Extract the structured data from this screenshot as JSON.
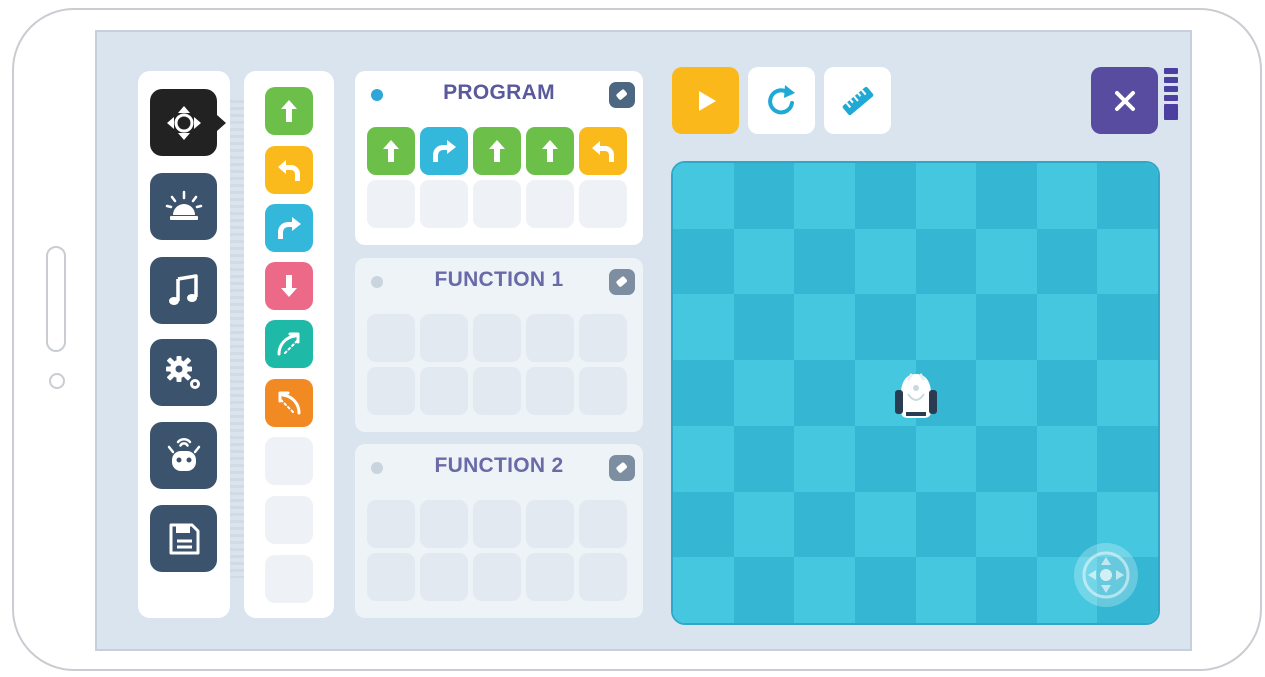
{
  "device": {
    "type": "phone-landscape"
  },
  "categories": [
    {
      "name": "movement",
      "icon": "move-icon",
      "active": true
    },
    {
      "name": "lights",
      "icon": "siren-icon",
      "active": false
    },
    {
      "name": "sound",
      "icon": "music-note-icon",
      "active": false
    },
    {
      "name": "settings",
      "icon": "gears-icon",
      "active": false
    },
    {
      "name": "robot",
      "icon": "robot-icon",
      "active": false
    },
    {
      "name": "save",
      "icon": "floppy-disk-icon",
      "active": false
    }
  ],
  "palette_blocks": [
    {
      "icon": "arrow-up-icon",
      "color": "#6cc04a"
    },
    {
      "icon": "turn-left-icon",
      "color": "#fbba1b"
    },
    {
      "icon": "turn-right-icon",
      "color": "#33b8dc"
    },
    {
      "icon": "arrow-down-icon",
      "color": "#ec6a88"
    },
    {
      "icon": "arc-right-icon",
      "color": "#1fb9a8"
    },
    {
      "icon": "arc-left-icon",
      "color": "#f28a24"
    },
    {
      "icon": "empty-slot",
      "color": "#eef1f5"
    },
    {
      "icon": "empty-slot",
      "color": "#eef1f5"
    },
    {
      "icon": "empty-slot",
      "color": "#eef1f5"
    }
  ],
  "program": {
    "title": "PROGRAM",
    "blocks": [
      "arrow-up-icon",
      "turn-right-icon",
      "arrow-up-icon",
      "arrow-up-icon",
      "turn-left-icon"
    ]
  },
  "function1": {
    "title": "FUNCTION 1",
    "blocks": []
  },
  "function2": {
    "title": "FUNCTION 2",
    "blocks": []
  },
  "toolbar": {
    "play": {
      "icon": "play-icon",
      "color": "#fbb81b"
    },
    "reset": {
      "icon": "rotate-icon"
    },
    "ruler": {
      "icon": "ruler-icon"
    },
    "close": {
      "icon": "close-icon",
      "color": "#574ca0"
    }
  },
  "board": {
    "columns": 8,
    "rows": 7,
    "colors": [
      "#45c7e0",
      "#35b7d3"
    ],
    "robot_icon": "robot-top-view-icon",
    "compass_icon": "compass-icon"
  }
}
